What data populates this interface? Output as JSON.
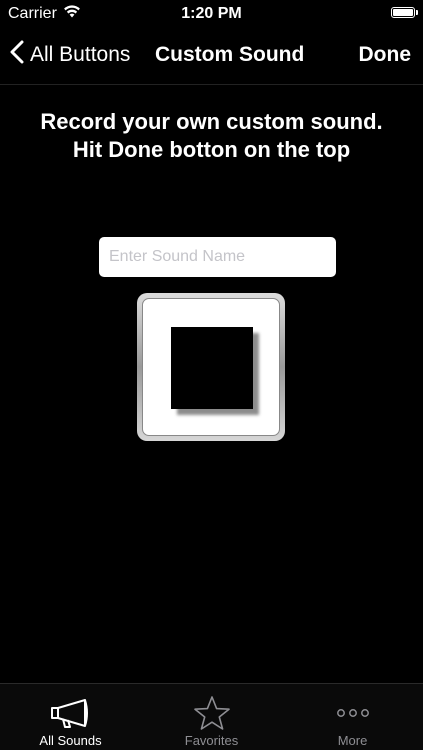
{
  "status_bar": {
    "carrier": "Carrier",
    "time": "1:20 PM",
    "wifi_icon": "wifi-icon",
    "battery_icon": "battery-icon"
  },
  "nav": {
    "back_label": "All Buttons",
    "title": "Custom Sound",
    "done_label": "Done"
  },
  "main": {
    "instruction": "Record your own custom sound. Hit Done botton on the top",
    "sound_name": {
      "value": "",
      "placeholder": "Enter Sound Name"
    },
    "record_button_icon": "stop-icon"
  },
  "tab_bar": {
    "tabs": [
      {
        "label": "All Sounds",
        "icon": "megaphone-icon",
        "active": true
      },
      {
        "label": "Favorites",
        "icon": "star-icon",
        "active": false
      },
      {
        "label": "More",
        "icon": "more-icon",
        "active": false
      }
    ]
  },
  "colors": {
    "background": "#000000",
    "text": "#ffffff",
    "tab_inactive": "#8e8e93",
    "input_placeholder": "#c4c4c9"
  }
}
